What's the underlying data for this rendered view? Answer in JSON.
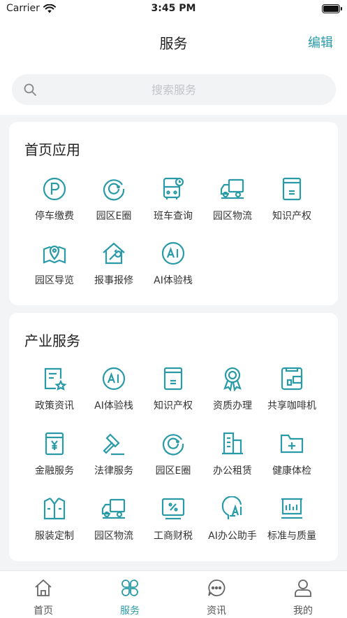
{
  "status": {
    "carrier": "Carrier",
    "time": "3:45 PM"
  },
  "nav": {
    "title": "服务",
    "edit": "编辑"
  },
  "search": {
    "placeholder": "搜索服务"
  },
  "colors": {
    "accent": "#2a9ba6"
  },
  "home_apps": {
    "title": "首页应用",
    "items": [
      {
        "label": "停车缴费",
        "icon": "parking-icon"
      },
      {
        "label": "园区E圈",
        "icon": "e-circle-icon"
      },
      {
        "label": "班车查询",
        "icon": "bus-icon"
      },
      {
        "label": "园区物流",
        "icon": "truck-icon"
      },
      {
        "label": "知识产权",
        "icon": "book-icon"
      },
      {
        "label": "园区导览",
        "icon": "map-pin-icon"
      },
      {
        "label": "报事报修",
        "icon": "house-wrench-icon"
      },
      {
        "label": "AI体验栈",
        "icon": "ai-circle-icon"
      }
    ]
  },
  "industry": {
    "title": "产业服务",
    "items": [
      {
        "label": "政策资讯",
        "icon": "policy-doc-icon"
      },
      {
        "label": "AI体验栈",
        "icon": "ai-circle-icon"
      },
      {
        "label": "知识产权",
        "icon": "book-icon"
      },
      {
        "label": "资质办理",
        "icon": "award-icon"
      },
      {
        "label": "共享咖啡机",
        "icon": "coffee-machine-icon"
      },
      {
        "label": "金融服务",
        "icon": "finance-icon"
      },
      {
        "label": "法律服务",
        "icon": "gavel-icon"
      },
      {
        "label": "园区E圈",
        "icon": "e-circle-icon"
      },
      {
        "label": "办公租赁",
        "icon": "building-icon"
      },
      {
        "label": "健康体检",
        "icon": "medical-folder-icon"
      },
      {
        "label": "服装定制",
        "icon": "shirt-icon"
      },
      {
        "label": "园区物流",
        "icon": "truck-icon"
      },
      {
        "label": "工商财税",
        "icon": "tax-icon"
      },
      {
        "label": "AI办公助手",
        "icon": "ai-head-icon"
      },
      {
        "label": "标准与质量",
        "icon": "ruler-chart-icon"
      }
    ]
  },
  "tabs": [
    {
      "label": "首页",
      "icon": "home-icon"
    },
    {
      "label": "服务",
      "icon": "clover-icon"
    },
    {
      "label": "资讯",
      "icon": "chat-icon"
    },
    {
      "label": "我的",
      "icon": "user-icon"
    }
  ]
}
